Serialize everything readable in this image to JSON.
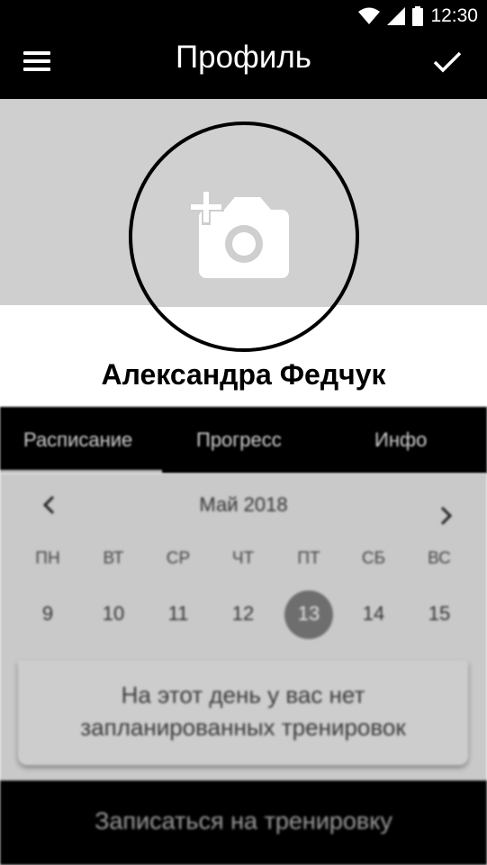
{
  "status_bar": {
    "time": "12:30",
    "icons": [
      "wifi-icon",
      "signal-icon",
      "battery-icon"
    ]
  },
  "app_bar": {
    "title": "Профиль",
    "menu_icon": "menu-icon",
    "confirm_icon": "check-icon"
  },
  "profile": {
    "name": "Александра Федчук",
    "avatar_icon": "add-photo-icon"
  },
  "tabs": [
    {
      "label": "Расписание",
      "selected": true
    },
    {
      "label": "Прогресс",
      "selected": false
    },
    {
      "label": "Инфо",
      "selected": false
    }
  ],
  "calendar": {
    "month": "Май 2018",
    "weekdays": [
      "ПН",
      "ВТ",
      "СР",
      "ЧТ",
      "ПТ",
      "СБ",
      "ВС"
    ],
    "days": [
      "9",
      "10",
      "11",
      "12",
      "13",
      "14",
      "15"
    ],
    "selected_day": "13",
    "empty_message_line1": "На этот день у вас нет",
    "empty_message_line2": "запланированных тренировок"
  },
  "actions": {
    "book_label": "Записаться на тренировку"
  },
  "colors": {
    "bar": "#000000",
    "cover": "#cfcfcf",
    "calendar_bg": "#c9c9c9",
    "selected_day": "#6e6e6e"
  }
}
